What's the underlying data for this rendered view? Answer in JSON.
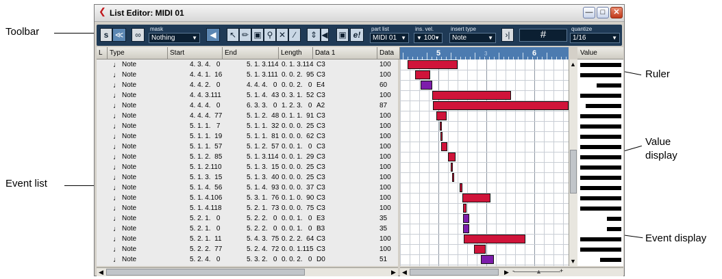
{
  "callouts": {
    "toolbar": "Toolbar",
    "ruler": "Ruler",
    "value_display": "Value\ndisplay",
    "event_list": "Event list",
    "event_display": "Event display"
  },
  "window": {
    "title": "List Editor: MIDI 01"
  },
  "toolbar": {
    "mask_label": "mask",
    "mask_value": "Nothing",
    "part_list_label": "part list",
    "part_list_value": "MIDI 01",
    "ins_vel_label": "ins. vel.",
    "ins_vel_value": "100",
    "insert_type_label": "insert type",
    "insert_type_value": "Note",
    "quantize_label": "quantize",
    "quantize_value": "1/16",
    "grid_symbol": "#"
  },
  "headers": {
    "l": "L",
    "type": "Type",
    "start": "Start",
    "end": "End",
    "length": "Length",
    "data1": "Data 1",
    "data2": "Data 2",
    "value": "Value"
  },
  "ruler": {
    "bar5": "5",
    "bar6": "6",
    "beat": "3"
  },
  "events": [
    {
      "type": "Note",
      "start": "4. 3. 4.   0",
      "end": "5. 1. 3.114",
      "length": "0. 1. 3.114",
      "data1": "C3",
      "data2": "100",
      "x0": 0.045,
      "x1": 0.34,
      "vel": 1.0,
      "color": "#d0143a"
    },
    {
      "type": "Note",
      "start": "4. 4. 1.  16",
      "end": "5. 1. 3.111",
      "length": "0. 0. 2.  95",
      "data1": "C3",
      "data2": "100",
      "x0": 0.09,
      "x1": 0.18,
      "vel": 1.0,
      "color": "#d0143a"
    },
    {
      "type": "Note",
      "start": "4. 4. 2.   0",
      "end": "4. 4. 4.   0",
      "length": "0. 0. 2.   0",
      "data1": "E4",
      "data2": "60",
      "x0": 0.12,
      "x1": 0.19,
      "vel": 0.6,
      "color": "#7d1dab"
    },
    {
      "type": "Note",
      "start": "4. 4. 3.111",
      "end": "5. 1. 4.  43",
      "length": "0. 3. 1.  52",
      "data1": "C3",
      "data2": "100",
      "x0": 0.19,
      "x1": 0.66,
      "vel": 1.0,
      "color": "#d0143a"
    },
    {
      "type": "Note",
      "start": "4. 4. 4.   0",
      "end": "6. 3. 3.   0",
      "length": "1. 2. 3.   0",
      "data1": "A2",
      "data2": "87",
      "x0": 0.195,
      "x1": 1.0,
      "vel": 0.87,
      "color": "#d0143a"
    },
    {
      "type": "Note",
      "start": "4. 4. 4.  77",
      "end": "5. 1. 2.  48",
      "length": "0. 1. 1.  91",
      "data1": "C3",
      "data2": "100",
      "x0": 0.215,
      "x1": 0.275,
      "vel": 1.0,
      "color": "#d0143a"
    },
    {
      "type": "Note",
      "start": "5. 1. 1.   7",
      "end": "5. 1. 1.  32",
      "length": "0. 0. 0.  25",
      "data1": "C3",
      "data2": "100",
      "x0": 0.235,
      "x1": 0.245,
      "vel": 1.0,
      "color": "#d0143a"
    },
    {
      "type": "Note",
      "start": "5. 1. 1.  19",
      "end": "5. 1. 1.  81",
      "length": "0. 0. 0.  62",
      "data1": "C3",
      "data2": "100",
      "x0": 0.238,
      "x1": 0.25,
      "vel": 1.0,
      "color": "#d0143a"
    },
    {
      "type": "Note",
      "start": "5. 1. 1.  57",
      "end": "5. 1. 2.  57",
      "length": "0. 0. 1.   0",
      "data1": "C3",
      "data2": "100",
      "x0": 0.245,
      "x1": 0.28,
      "vel": 1.0,
      "color": "#d0143a"
    },
    {
      "type": "Note",
      "start": "5. 1. 2.  85",
      "end": "5. 1. 3.114",
      "length": "0. 0. 1.  29",
      "data1": "C3",
      "data2": "100",
      "x0": 0.285,
      "x1": 0.33,
      "vel": 1.0,
      "color": "#d0143a"
    },
    {
      "type": "Note",
      "start": "5. 1. 2.110",
      "end": "5. 1. 3.  15",
      "length": "0. 0. 0.  25",
      "data1": "C3",
      "data2": "100",
      "x0": 0.3,
      "x1": 0.31,
      "vel": 1.0,
      "color": "#d0143a"
    },
    {
      "type": "Note",
      "start": "5. 1. 3.  15",
      "end": "5. 1. 3.  40",
      "length": "0. 0. 0.  25",
      "data1": "C3",
      "data2": "100",
      "x0": 0.31,
      "x1": 0.32,
      "vel": 1.0,
      "color": "#d0143a"
    },
    {
      "type": "Note",
      "start": "5. 1. 4.  56",
      "end": "5. 1. 4.  93",
      "length": "0. 0. 0.  37",
      "data1": "C3",
      "data2": "100",
      "x0": 0.355,
      "x1": 0.37,
      "vel": 1.0,
      "color": "#d0143a"
    },
    {
      "type": "Note",
      "start": "5. 1. 4.106",
      "end": "5. 3. 1.  76",
      "length": "0. 1. 0.  90",
      "data1": "C3",
      "data2": "100",
      "x0": 0.37,
      "x1": 0.535,
      "vel": 1.0,
      "color": "#d0143a"
    },
    {
      "type": "Note",
      "start": "5. 1. 4.118",
      "end": "5. 2. 1.  73",
      "length": "0. 0. 0.  75",
      "data1": "C3",
      "data2": "100",
      "x0": 0.375,
      "x1": 0.395,
      "vel": 1.0,
      "color": "#d0143a"
    },
    {
      "type": "Note",
      "start": "5. 2. 1.   0",
      "end": "5. 2. 2.   0",
      "length": "0. 0. 1.   0",
      "data1": "E3",
      "data2": "35",
      "x0": 0.375,
      "x1": 0.41,
      "vel": 0.35,
      "color": "#7d1dab"
    },
    {
      "type": "Note",
      "start": "5. 2. 1.   0",
      "end": "5. 2. 2.   0",
      "length": "0. 0. 1.   0",
      "data1": "B3",
      "data2": "35",
      "x0": 0.375,
      "x1": 0.41,
      "vel": 0.35,
      "color": "#7d1dab"
    },
    {
      "type": "Note",
      "start": "5. 2. 1.  11",
      "end": "5. 4. 3.  75",
      "length": "0. 2. 2.  64",
      "data1": "C3",
      "data2": "100",
      "x0": 0.38,
      "x1": 0.745,
      "vel": 1.0,
      "color": "#d0143a"
    },
    {
      "type": "Note",
      "start": "5. 2. 2.  77",
      "end": "5. 2. 4.  72",
      "length": "0. 0. 1.115",
      "data1": "C3",
      "data2": "100",
      "x0": 0.44,
      "x1": 0.51,
      "vel": 1.0,
      "color": "#d0143a"
    },
    {
      "type": "Note",
      "start": "5. 2. 4.   0",
      "end": "5. 3. 2.   0",
      "length": "0. 0. 2.   0",
      "data1": "D0",
      "data2": "51",
      "x0": 0.48,
      "x1": 0.555,
      "vel": 0.51,
      "color": "#7d1dab"
    }
  ]
}
